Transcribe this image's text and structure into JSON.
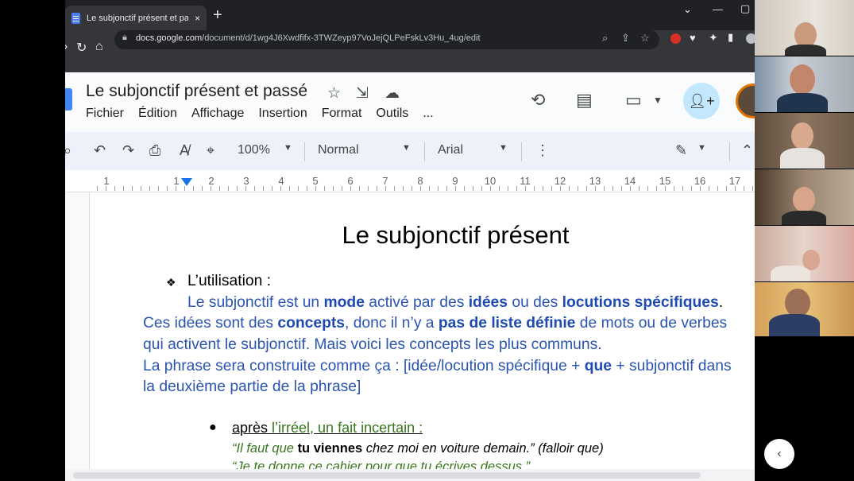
{
  "browser": {
    "tab_title": "Le subjonctif présent et passé - ",
    "tab_close": "×",
    "new_tab": "+",
    "url_domain": "docs.google.com",
    "url_path": "/document/d/1wg4J6Xwdfifx-3TWZeyp97VoJejQLPeFskLv3Hu_4ug/edit"
  },
  "docs": {
    "title": "Le subjonctif présent et passé",
    "menu": [
      "Fichier",
      "Édition",
      "Affichage",
      "Insertion",
      "Format",
      "Outils",
      "..."
    ]
  },
  "toolbar": {
    "zoom": "100%",
    "style": "Normal",
    "font": "Arial"
  },
  "ruler": {
    "labels": [
      "1",
      "1",
      "2",
      "3",
      "4",
      "5",
      "6",
      "7",
      "8",
      "9",
      "10",
      "11",
      "12",
      "13",
      "14",
      "15",
      "16",
      "17"
    ]
  },
  "document": {
    "heading": "Le subjonctif présent",
    "section_label": "L’utilisation :",
    "line1": {
      "a": "Le subjonctif est un ",
      "b": "mode",
      "c": " activé par des ",
      "d": "idées",
      "e": " ou des ",
      "f": "locutions spécifiques",
      "g": "."
    },
    "line2": {
      "a": "Ces idées sont des ",
      "b": "concepts",
      "c": ", donc il n’y a ",
      "d": "pas de liste définie",
      "e": " de mots ou de verbes"
    },
    "line3": "qui activent le subjonctif. Mais voici les concepts les plus communs.",
    "line4": {
      "a": "La phrase sera construite comme ça : [idée/locution spécifique + ",
      "b": "que",
      "c": " + subjonctif dans"
    },
    "line5": "la deuxième partie de la phrase]",
    "bullet": {
      "a": "après",
      "b": " l’irréel, un fait incertain :"
    },
    "example1": {
      "a": "“Il faut que ",
      "b": "tu viennes",
      "c": " chez moi en voiture demain.” (falloir que)"
    },
    "example2": "“Je te donne ce cahier pour que tu écrives dessus.”"
  },
  "icons": {
    "star": "star-icon",
    "move": "folder-move-icon",
    "cloud": "cloud-saved-icon",
    "history": "history-icon",
    "comments": "comments-icon",
    "meet": "meet-camera-icon",
    "share": "add-person-icon"
  },
  "colors": {
    "doc_blue": "#2a54b0",
    "green": "#38761d",
    "share_bg": "#c2e7ff"
  }
}
